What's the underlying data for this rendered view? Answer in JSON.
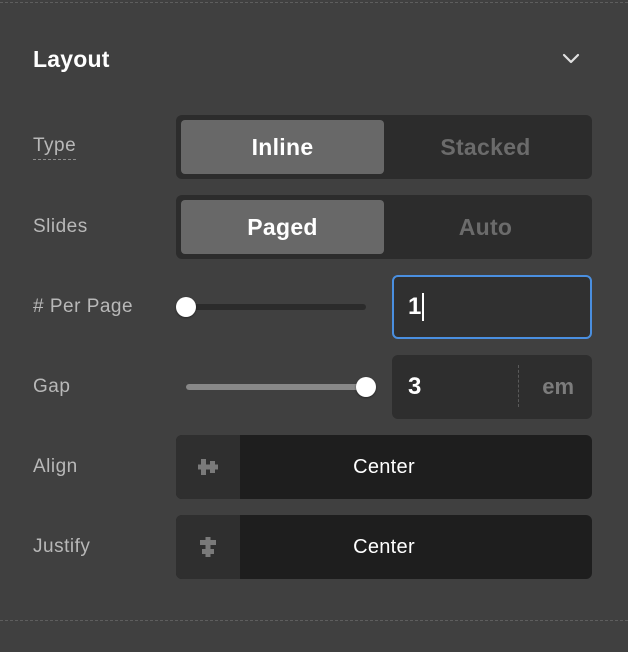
{
  "panel": {
    "title": "Layout",
    "collapse_icon": "chevron-down-icon"
  },
  "type": {
    "label": "Type",
    "options": [
      "Inline",
      "Stacked"
    ],
    "selected": "Inline"
  },
  "slides": {
    "label": "Slides",
    "options": [
      "Paged",
      "Auto"
    ],
    "selected": "Paged"
  },
  "per_page": {
    "label": "# Per Page",
    "value": "1",
    "slider_fraction": 0.0
  },
  "gap": {
    "label": "Gap",
    "value": "3",
    "unit": "em",
    "slider_fraction": 1.0
  },
  "align": {
    "label": "Align",
    "value": "Center",
    "icon": "align-center-icon"
  },
  "justify": {
    "label": "Justify",
    "value": "Center",
    "icon": "justify-center-icon"
  },
  "colors": {
    "focus_ring": "#4a8fe0",
    "active_segment": "#686868",
    "panel_bg": "#404040"
  }
}
